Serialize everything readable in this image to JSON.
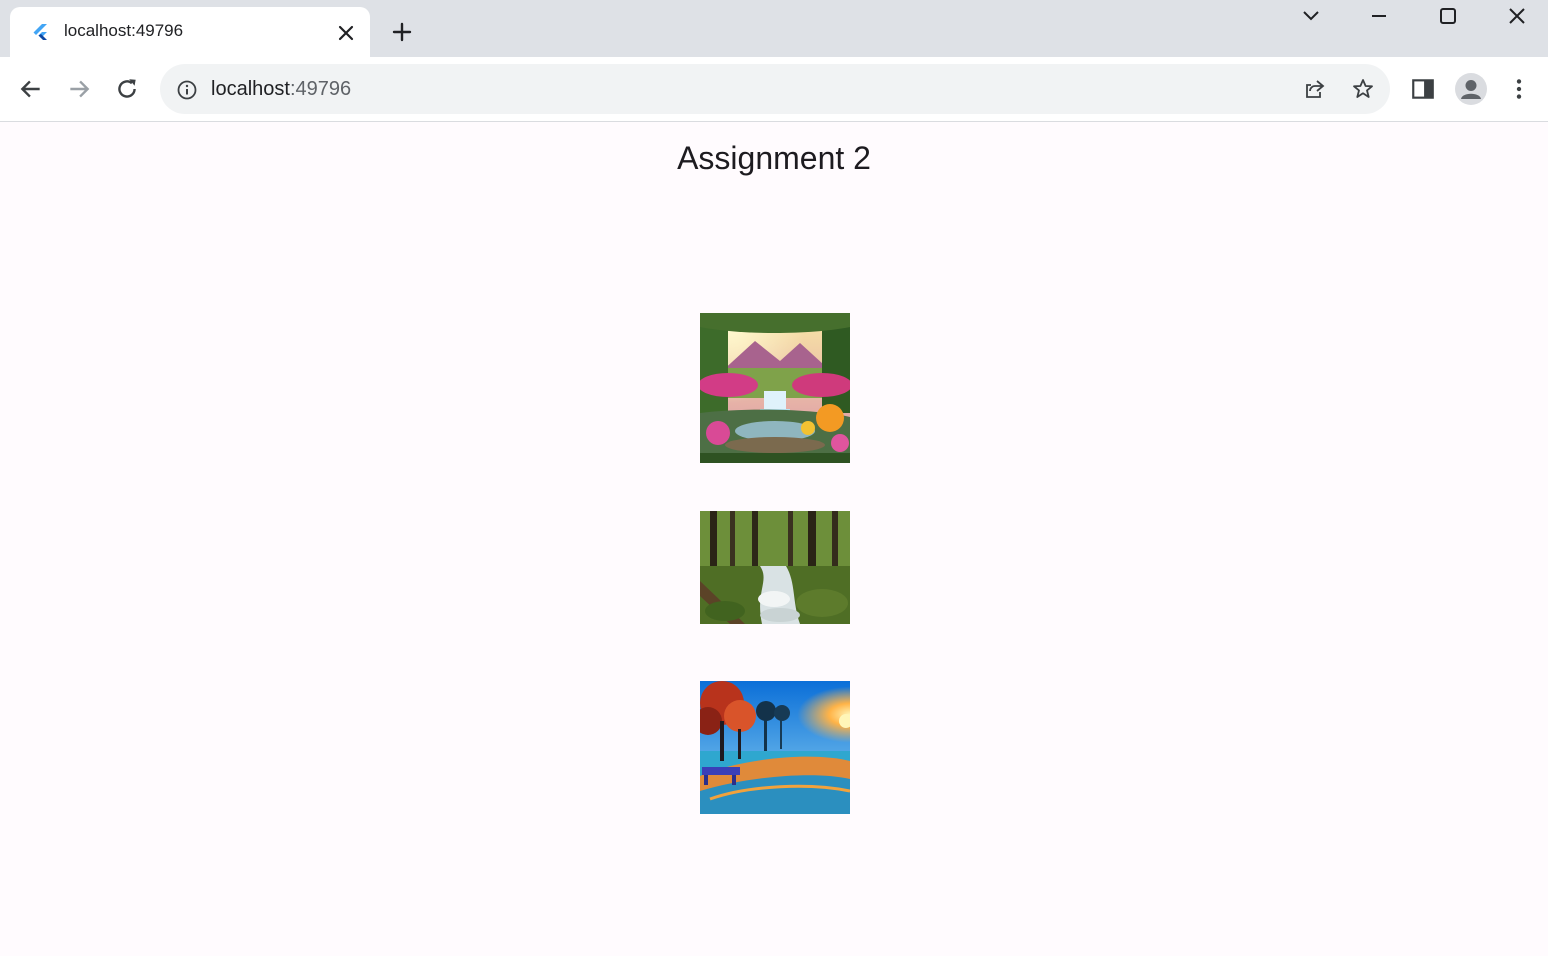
{
  "browser": {
    "tab": {
      "title": "localhost:49796",
      "favicon": "flutter-icon",
      "close_icon": "close-icon"
    },
    "new_tab_icon": "plus-icon",
    "window_controls": [
      "chevron-down-icon",
      "minimize-icon",
      "maximize-icon",
      "close-icon"
    ],
    "nav": [
      "back-arrow-icon",
      "forward-arrow-icon",
      "reload-icon"
    ],
    "address": {
      "host": "localhost",
      "port": ":49796"
    },
    "toolbar_icons": [
      "share-icon",
      "star-icon",
      "side-panel-icon",
      "profile-avatar",
      "more-vert-icon"
    ]
  },
  "page": {
    "title": "Assignment 2",
    "images": [
      "waterfall-flowers-image",
      "forest-stream-image",
      "autumn-park-sunset-image"
    ]
  },
  "colors": {
    "tabstrip": "#dee1e6",
    "page_background": "#fffbfe",
    "omnibox": "#f1f3f4"
  }
}
